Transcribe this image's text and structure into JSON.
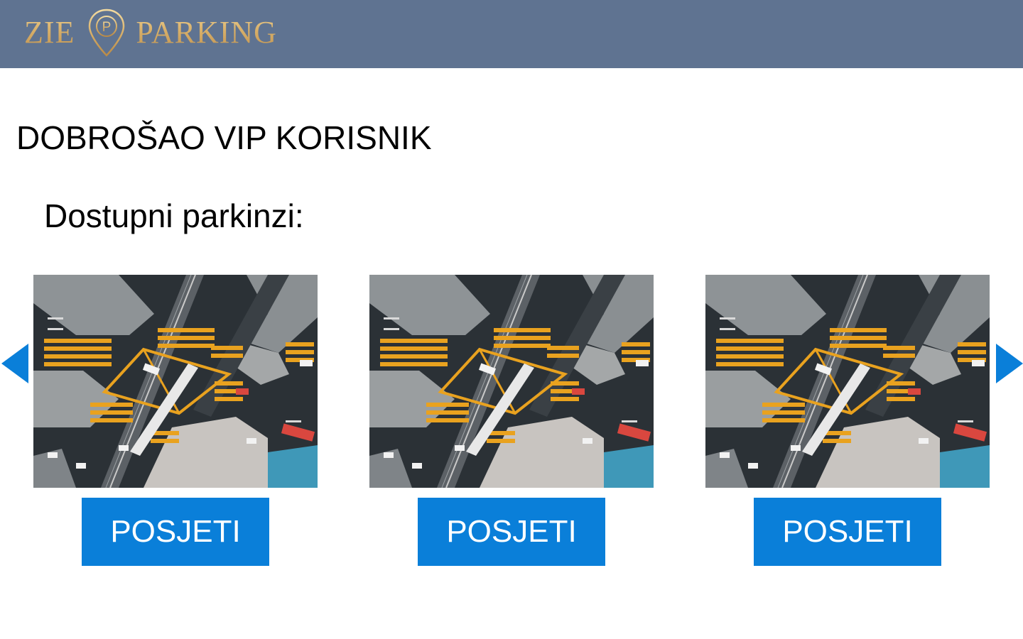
{
  "header": {
    "logo_left": "ZIE",
    "logo_right": "PARKING",
    "logo_pin_letter": "P",
    "background_color": "#5f7391",
    "logo_color": "#d8b06a"
  },
  "main": {
    "welcome": "DOBROŠAO VIP KORISNIK",
    "subtitle": "Dostupni parkinzi:"
  },
  "carousel": {
    "prev_icon": "triangle-left-icon",
    "next_icon": "triangle-right-icon",
    "arrow_color": "#0a7fd9",
    "cards": [
      {
        "image": "aerial-intersection-photo",
        "button_label": "POSJETI"
      },
      {
        "image": "aerial-intersection-photo",
        "button_label": "POSJETI"
      },
      {
        "image": "aerial-intersection-photo",
        "button_label": "POSJETI"
      }
    ],
    "button_color": "#0a7fd9"
  }
}
